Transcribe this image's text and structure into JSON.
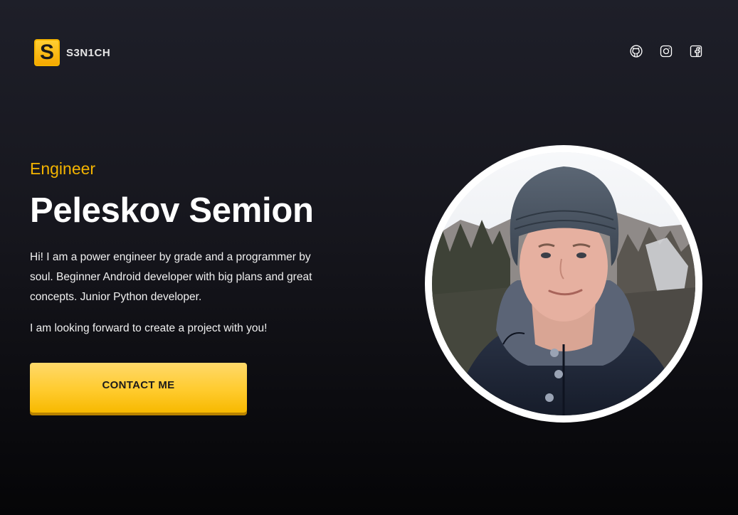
{
  "brand": {
    "logo_letter": "S",
    "name": "S3N1CH",
    "accent_color": "#f4b400"
  },
  "socials": [
    {
      "icon": "github-icon"
    },
    {
      "icon": "instagram-icon"
    },
    {
      "icon": "facebook-icon"
    }
  ],
  "hero": {
    "role": "Engineer",
    "name": "Peleskov Semion",
    "bio": "Hi! I am a power engineer by grade and a programmer by soul. Beginner Android developer with big plans and great concepts. Junior Python developer.",
    "bio_secondary": "I am looking forward to create a project with you!",
    "cta_label": "CONTACT ME"
  },
  "colors": {
    "background_top": "#1e1f29",
    "background_bottom": "#050507",
    "button": "#ffcb2e"
  }
}
